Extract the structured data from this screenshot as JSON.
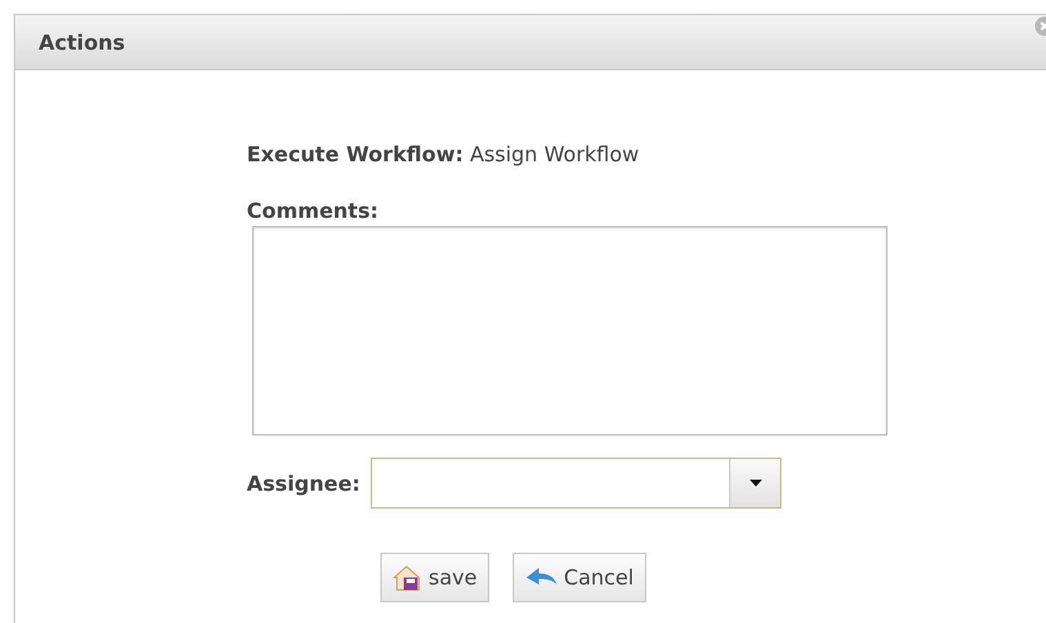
{
  "dialog": {
    "title": "Actions"
  },
  "workflow": {
    "label": "Execute Workflow:",
    "value": "Assign Workflow"
  },
  "comments": {
    "label": "Comments:"
  },
  "assignee": {
    "label": "Assignee:"
  },
  "buttons": [
    {
      "label": "save",
      "kind": "save"
    },
    {
      "label": "Cancel",
      "kind": "cancel"
    }
  ]
}
